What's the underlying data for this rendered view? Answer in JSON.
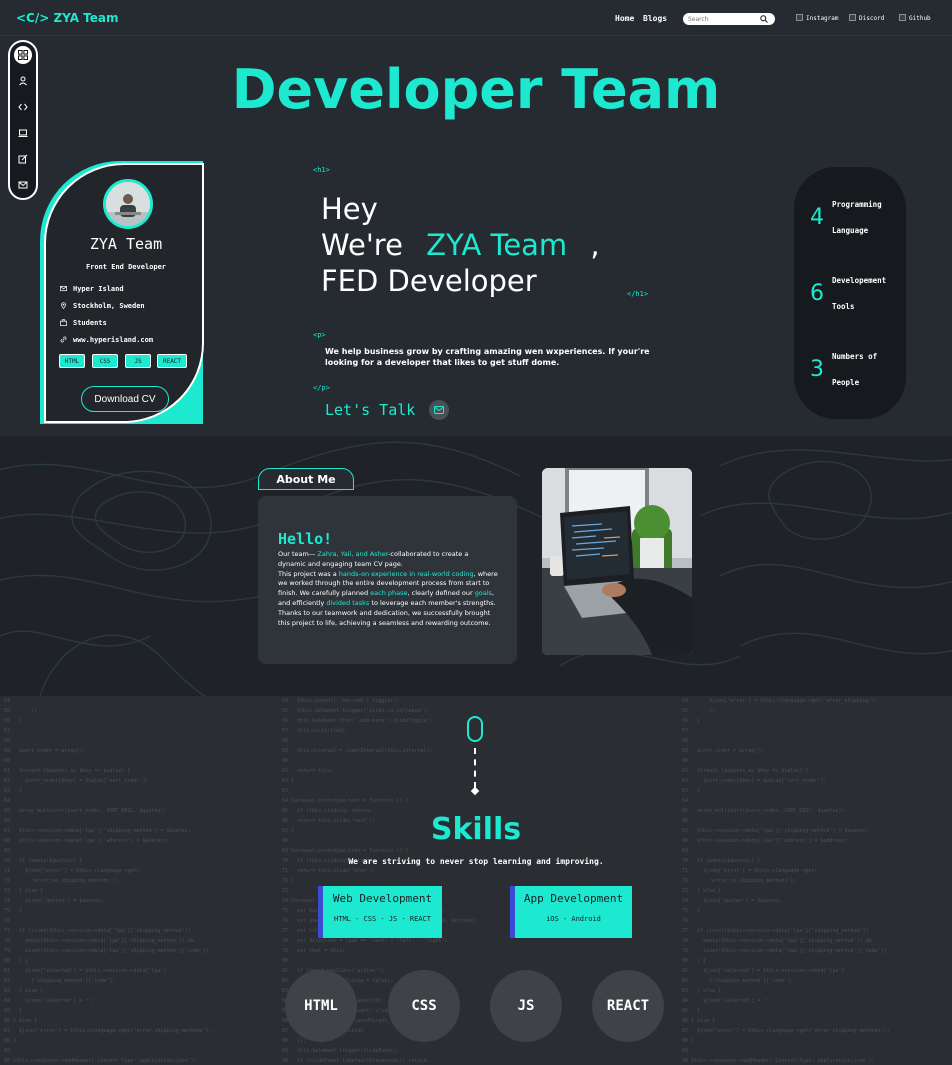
{
  "header": {
    "logo": "<C/>  ZYA Team",
    "nav": [
      "Home",
      "Blogs"
    ],
    "search_placeholder": "Search",
    "social": [
      "Instagram",
      "Discord",
      "Github"
    ]
  },
  "hero": {
    "title": "Developer Team",
    "tag_h1_open": "<h1>",
    "tag_h1_close": "</h1>",
    "tag_p_open": "<p>",
    "tag_p_close": "</p>",
    "line1": "Hey",
    "line2_prefix": "We're",
    "line2_name": "ZYA Team",
    "line2_suffix": ",",
    "line3": "FED Developer",
    "description": "We help business grow by crafting amazing wen wxperiences. If your're looking for a developer that likes to get stuff dome.",
    "cta": "Let's Talk"
  },
  "profile": {
    "name": "ZYA Team",
    "role": "Front End Developer",
    "info": [
      "Hyper Island",
      "Stockholm, Sweden",
      "Students",
      "www.hyperisland.com"
    ],
    "chips": [
      "HTML",
      "CSS",
      "JS",
      "REACT"
    ],
    "download": "Download CV"
  },
  "stats": [
    {
      "value": "4",
      "label": "Programming Language"
    },
    {
      "value": "6",
      "label": "Developement Tools"
    },
    {
      "value": "3",
      "label": "Numbers of People"
    }
  ],
  "about": {
    "tab": "About Me",
    "greeting": "Hello!",
    "t1": "Our team— ",
    "h1": "Zahra, Yali, and Asher",
    "t2": "-collaborated to create a dynamic and engaging team CV page.",
    "t3": "This project was a ",
    "h2": "hands-on experience in real-world coding",
    "t4": ", where we worked through the entire development process from start to finish. We carefully planned ",
    "h3": "each phase",
    "t5": ", clearly defined our ",
    "h4": "goals",
    "t6": ", and efficiently ",
    "h5": "divided tasks",
    "t7": " to leverage each member's strengths. Thanks to our teamwork and dedication, we successfully brought this project to life, achieving a seamless and rewarding outcome."
  },
  "skills": {
    "title": "Skills",
    "subtitle": "We are striving to never stop learning and improving.",
    "boxes": [
      {
        "title": "Web Development",
        "sub": "HTML - CSS - JS - REACT"
      },
      {
        "title": "App Development",
        "sub": "iOS - Android"
      }
    ],
    "bubbles": [
      "HTML",
      "CSS",
      "JS",
      "REACT"
    ]
  },
  "colors": {
    "accent": "#1de9d1",
    "background": "#262b31",
    "panel": "#16191d",
    "box_border": "#3b4bd6"
  }
}
